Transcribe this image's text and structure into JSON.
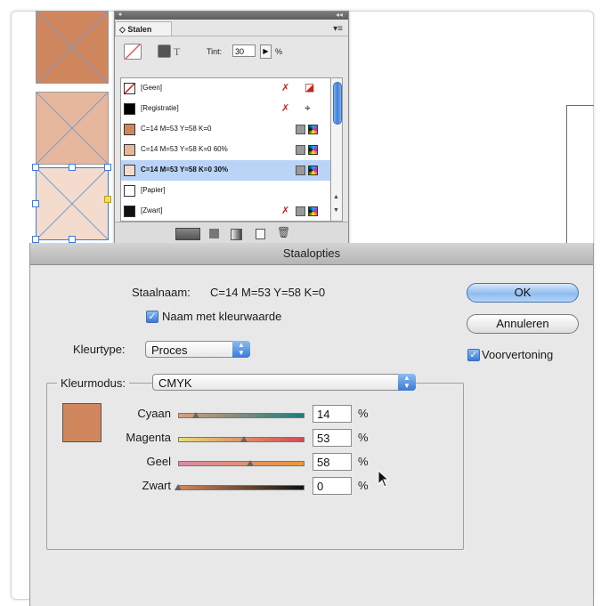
{
  "swatches_panel": {
    "tab_label": "◇ Stalen",
    "tint_label": "Tint:",
    "tint_value": "30",
    "tint_unit": "%",
    "swatches": [
      {
        "name": "[Geen]",
        "color": "#ffffff",
        "selected": false
      },
      {
        "name": "[Registratie]",
        "color": "#000000",
        "selected": false
      },
      {
        "name": "C=14 M=53 Y=58 K=0",
        "color": "#d0875e",
        "selected": false
      },
      {
        "name": "C=14 M=53 Y=58 K=0 60%",
        "color": "#e6b79c",
        "selected": false
      },
      {
        "name": "C=14 M=53 Y=58 K=0 30%",
        "color": "#f3dbcd",
        "selected": true
      },
      {
        "name": "[Papier]",
        "color": "#ffffff",
        "selected": false
      },
      {
        "name": "[Zwart]",
        "color": "#111111",
        "selected": false
      }
    ]
  },
  "canvas_tiles": [
    {
      "color": "#d0875e"
    },
    {
      "color": "#e6b79c"
    },
    {
      "color": "#f3dbcd"
    }
  ],
  "dialog": {
    "title": "Staalopties",
    "swatch_name_label": "Staalnaam:",
    "swatch_name_value": "C=14 M=53 Y=58 K=0",
    "name_with_value_label": "Naam met kleurwaarde",
    "name_with_value_checked": true,
    "color_type_label": "Kleurtype:",
    "color_type_value": "Proces",
    "color_mode_label": "Kleurmodus:",
    "color_mode_value": "CMYK",
    "ok_label": "OK",
    "cancel_label": "Annuleren",
    "preview_label": "Voorvertoning",
    "preview_checked": true,
    "preview_color": "#d0875e",
    "sliders": [
      {
        "label": "Cyaan",
        "value": "14",
        "unit": "%",
        "fraction": 0.14,
        "gradient": [
          "#d8a07c",
          "#1f7a7c"
        ]
      },
      {
        "label": "Magenta",
        "value": "53",
        "unit": "%",
        "fraction": 0.53,
        "gradient": [
          "#e8dc7a",
          "#cf4a57"
        ]
      },
      {
        "label": "Geel",
        "value": "58",
        "unit": "%",
        "fraction": 0.58,
        "gradient": [
          "#d88aa8",
          "#e69a3a"
        ]
      },
      {
        "label": "Zwart",
        "value": "0",
        "unit": "%",
        "fraction": 0.0,
        "gradient": [
          "#d0875e",
          "#111111"
        ]
      }
    ]
  }
}
